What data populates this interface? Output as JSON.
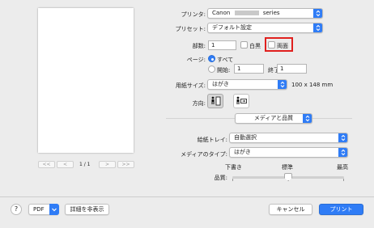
{
  "dialog": {
    "printer_label": "プリンタ:",
    "printer_value": "Canon",
    "printer_suffix": "series",
    "preset_label": "プリセット:",
    "preset_value": "デフォルト設定",
    "copies_label": "部数:",
    "copies_value": "1",
    "bw_label": "白黒",
    "duplex_label": "両面",
    "pages_label": "ページ:",
    "pages_all_label": "すべて",
    "pages_from_label": "開始:",
    "pages_from_value": "1",
    "pages_to_label": "終了:",
    "pages_to_value": "1",
    "paper_size_label": "用紙サイズ:",
    "paper_size_value": "はがき",
    "paper_size_dims": "100 x 148 mm",
    "orientation_label": "方向:",
    "section_value": "メディアと品質",
    "feed_label": "給紙トレイ:",
    "feed_value": "自動選択",
    "media_type_label": "メディアのタイプ:",
    "media_type_value": "はがき",
    "quality_label": "品質:",
    "quality_draft": "下書き",
    "quality_standard": "標準",
    "quality_high": "最高",
    "quality_level": 0.5
  },
  "preview": {
    "first": "<<",
    "prev": "<",
    "page_indicator": "1 / 1",
    "next": ">",
    "last": ">>"
  },
  "footer": {
    "help": "?",
    "pdf": "PDF",
    "hide_details": "詳細を非表示",
    "cancel": "キャンセル",
    "print": "プリント"
  },
  "colors": {
    "accent": "#2f7cf6",
    "highlight_border": "#e0201e"
  }
}
